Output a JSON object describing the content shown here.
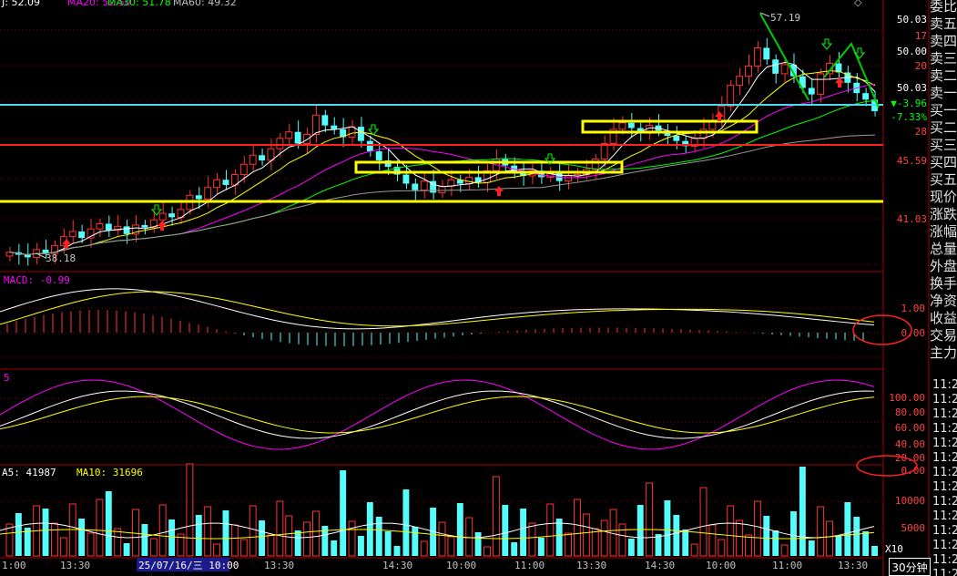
{
  "top_legend": {
    "ma10": "J: 52.09",
    "ma20": "MA20: 52.50",
    "ma30": "MA30: 51.78",
    "ma60": "MA60: 49.32"
  },
  "high_label": "57.19",
  "low_label": "38.18",
  "price_ticks": [
    "50.03",
    "17",
    "50.00",
    "20",
    "50.03",
    "▼-3.96",
    "-7.33%",
    "28",
    "45.59",
    "41.03"
  ],
  "macd": {
    "label": "MACD: -0.99",
    "ticks": [
      "1.00",
      "0.00"
    ]
  },
  "kdj": {
    "label": "5",
    "ticks": [
      "100.00",
      "80.00",
      "60.00",
      "40.00",
      "20.00",
      "0.00"
    ]
  },
  "volume": {
    "ma5": "A5: 41987",
    "ma10": "MA10: 31696",
    "ticks": [
      "10000",
      "5000"
    ],
    "unit": "X10"
  },
  "time_axis": [
    "1:00",
    "13:30",
    "11:00",
    "13:30",
    "14:30",
    "10:00",
    "11:00",
    "13:30",
    "14:30",
    "10:00",
    "11:00",
    "13:30"
  ],
  "cursor_date": "25/07/16/三 10:00",
  "period": "30分钟",
  "side_panel": [
    "委比",
    "卖五",
    "卖四",
    "卖三",
    "卖二",
    "卖一",
    "买一",
    "买二",
    "买三",
    "买四",
    "买五",
    "现价",
    "涨跌",
    "涨幅",
    "总量",
    "外盘",
    "换手",
    "净资",
    "收益",
    "交易",
    "主力"
  ],
  "time_list": [
    "11:2",
    "11:2",
    "11:2",
    "11:2",
    "11:2",
    "11:2",
    "11:2",
    "11:2",
    "11:2",
    "11:2",
    "11:2",
    "11:2",
    "11:2",
    "11:2"
  ],
  "colors": {
    "up": "#ff3333",
    "down": "#54fcfc",
    "ma1": "#ffffff",
    "ma2": "#ffff00",
    "ma3": "#ff00ff",
    "ma4": "#00ff00",
    "grid": "#8b0000"
  },
  "chart_data": [
    {
      "type": "candlestick",
      "title": "",
      "ylim": [
        37.5,
        58.5
      ],
      "high": 57.19,
      "low": 38.18,
      "close": [
        39.0,
        38.8,
        38.6,
        39.2,
        38.9,
        39.5,
        40.2,
        40.6,
        40.1,
        40.8,
        41.2,
        40.7,
        41.0,
        40.4,
        41.1,
        40.9,
        41.5,
        42.0,
        41.7,
        42.3,
        43.4,
        43.1,
        44.0,
        44.6,
        44.2,
        45.0,
        45.8,
        46.5,
        46.1,
        47.0,
        47.8,
        48.3,
        47.4,
        48.1,
        49.6,
        48.8,
        48.5,
        47.9,
        48.7,
        47.6,
        46.8,
        46.1,
        45.6,
        45.0,
        44.3,
        43.8,
        44.5,
        43.6,
        44.1,
        44.6,
        44.3,
        44.8,
        44.4,
        45.3,
        46.2,
        45.7,
        45.1,
        44.9,
        45.3,
        44.8,
        45.2,
        44.5,
        44.9,
        45.0,
        45.4,
        46.2,
        47.4,
        48.5,
        49.0,
        48.6,
        48.2,
        48.8,
        48.4,
        48.0,
        47.6,
        47.2,
        47.8,
        48.5,
        49.2,
        50.3,
        51.9,
        52.6,
        53.4,
        54.8,
        53.9,
        52.8,
        53.5,
        52.6,
        51.7,
        51.2,
        52.8,
        53.6,
        52.9,
        52.1,
        51.3,
        50.8,
        49.9
      ]
    },
    {
      "type": "line",
      "title": "",
      "indicator": "MACD",
      "value": -0.99
    },
    {
      "type": "line",
      "title": "",
      "indicator": "KDJ",
      "ylim": [
        0,
        100
      ]
    },
    {
      "type": "bar",
      "title": "",
      "indicator": "VOL",
      "ma5": 41987,
      "ma10": 31696,
      "unit": "X10",
      "ylim": [
        0,
        13000
      ]
    }
  ]
}
